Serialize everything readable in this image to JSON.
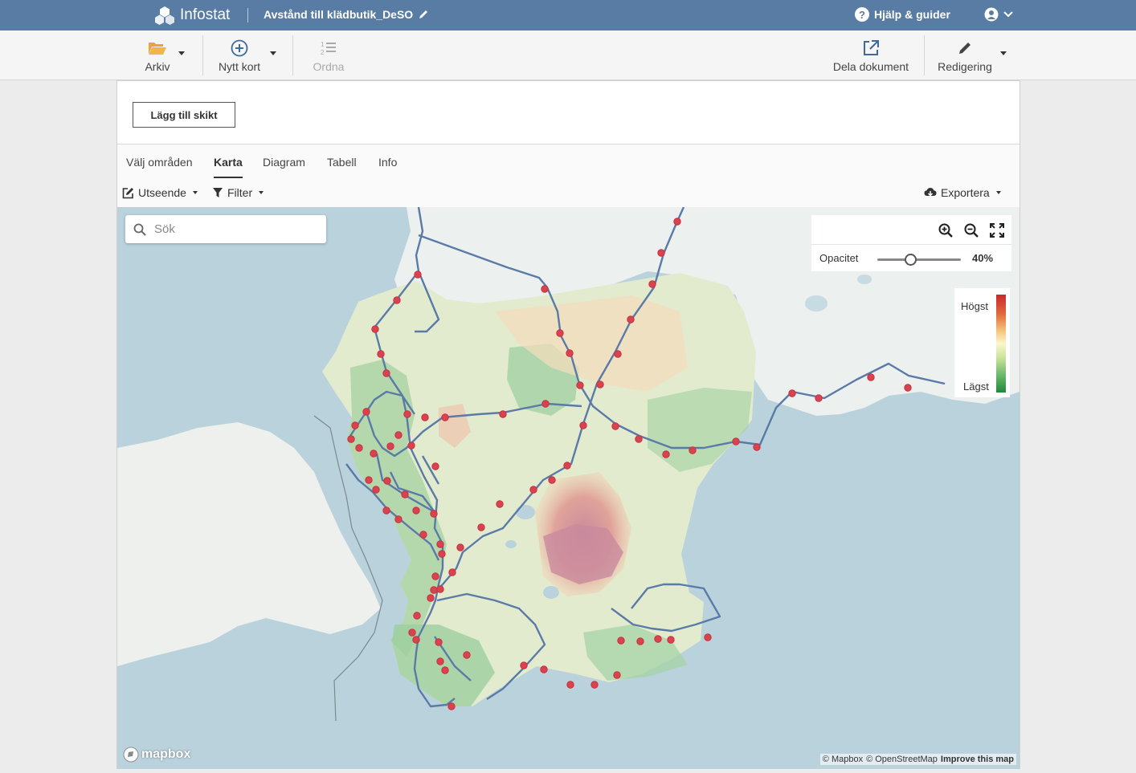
{
  "app": {
    "name": "Infostat",
    "doc_title": "Avstånd till klädbutik_DeSO"
  },
  "topbar": {
    "help_label": "Hjälp & guider"
  },
  "toolbar": {
    "arkiv": "Arkiv",
    "nytt_kort": "Nytt kort",
    "ordna": "Ordna",
    "dela": "Dela dokument",
    "redigering": "Redigering"
  },
  "card": {
    "add_layer": "Lägg till skikt",
    "tabs": [
      {
        "label": "Välj områden",
        "active": false
      },
      {
        "label": "Karta",
        "active": true
      },
      {
        "label": "Diagram",
        "active": false
      },
      {
        "label": "Tabell",
        "active": false
      },
      {
        "label": "Info",
        "active": false
      }
    ],
    "options": {
      "appearance": "Utseende",
      "filter": "Filter",
      "export": "Exportera"
    }
  },
  "map": {
    "search_placeholder": "Sök",
    "opacity_label": "Opacitet",
    "opacity_value": "40%",
    "opacity_fraction": 0.4,
    "legend": {
      "high": "Högst",
      "low": "Lägst"
    },
    "mapbox_logo": "mapbox",
    "attribution": {
      "mapbox": "© Mapbox",
      "osm": "© OpenStreetMap",
      "improve": "Improve this map"
    }
  },
  "colors": {
    "topbar": "#587ca3",
    "route": "#5a7aa8",
    "station": "#d9434f",
    "high": "#c9282c",
    "low": "#1d8a3c"
  }
}
